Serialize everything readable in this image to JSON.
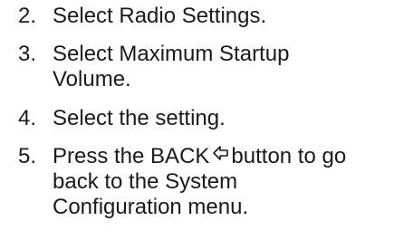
{
  "steps": [
    {
      "number": "2.",
      "lines": [
        "Select Radio Settings."
      ]
    },
    {
      "number": "3.",
      "lines": [
        "Select Maximum Startup",
        "Volume."
      ]
    },
    {
      "number": "4.",
      "lines": [
        "Select the setting."
      ]
    },
    {
      "number": "5.",
      "line1_before_icon": "Press the BACK",
      "line1_after_icon": "button to go",
      "lines_rest": [
        "back to the System",
        "Configuration menu."
      ],
      "icon": "back-arrow-icon"
    }
  ]
}
